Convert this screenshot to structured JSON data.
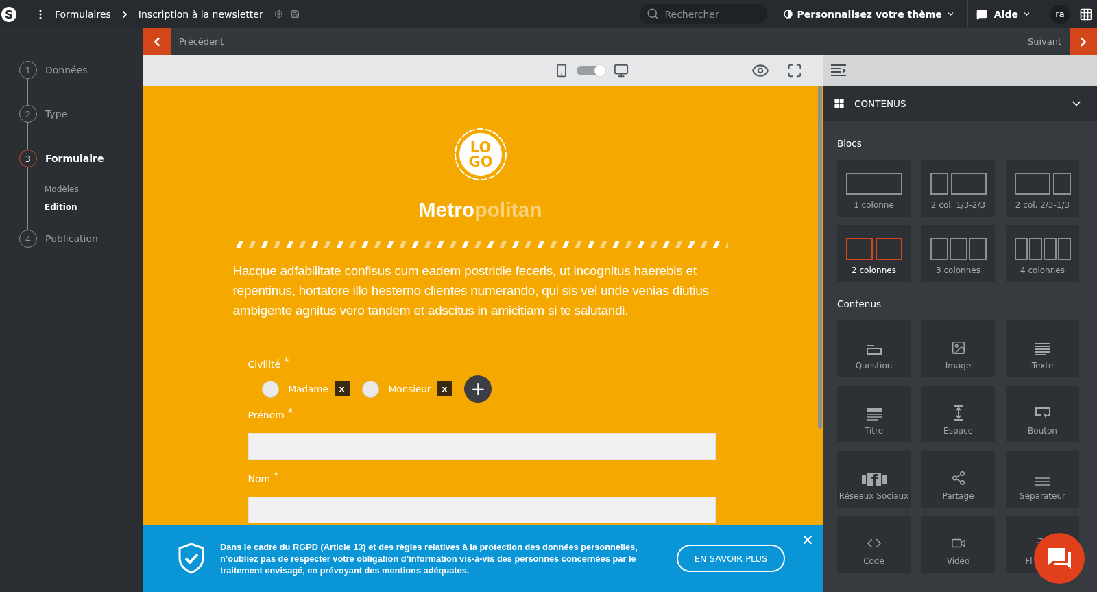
{
  "topbar": {
    "breadcrumbs": [
      {
        "label": "Formulaires"
      },
      {
        "label": "Inscription à la newsletter"
      }
    ],
    "search": {
      "placeholder": "Rechercher"
    },
    "theme": "Personnalisez votre thème",
    "help": "Aide",
    "avatar": "ra"
  },
  "nav": {
    "previous": "Précédent",
    "next": "Suivant"
  },
  "steps": [
    {
      "number": "1",
      "label": "Données",
      "selected": false
    },
    {
      "number": "2",
      "label": "Type",
      "selected": false
    },
    {
      "number": "3",
      "label": "Formulaire",
      "selected": true,
      "children": [
        {
          "label": "Modèles",
          "selected": false
        },
        {
          "label": "Edition",
          "selected": true
        }
      ]
    },
    {
      "number": "4",
      "label": "Publication",
      "selected": false
    }
  ],
  "toolbar": {
    "desktop": true
  },
  "canvas": {
    "logo": [
      "LO",
      "GO"
    ],
    "brand": {
      "strong": "Metro",
      "faded": "politan"
    },
    "intro": "Hacque adfabilitate confisus cum eadem postridie feceris, ut incognitus haerebis et repentinus, hortatore illo hesterno clientes numerando, qui sis vel unde venias diutius ambigente agnitus vero tandem et adscitus in amicitiam si te salutandi.",
    "fields": [
      {
        "kind": "radio",
        "label": "Civilité",
        "required_mark": "*",
        "options": [
          {
            "label": "Madame",
            "selected": false,
            "remove": "x"
          },
          {
            "label": "Monsieur",
            "selected": false,
            "remove": "x"
          }
        ],
        "add": "+"
      },
      {
        "kind": "text",
        "label": "Prénom",
        "required_mark": "*"
      },
      {
        "kind": "text",
        "label": "Nom",
        "required_mark": "*"
      }
    ]
  },
  "panel": {
    "title": "CONTENUS",
    "expanded": true,
    "sections": [
      {
        "title": "Blocs",
        "items": [
          {
            "kind": "one-col",
            "label": "1 colonne",
            "selected": false
          },
          {
            "kind": "third-twothirds",
            "label": "2 col. 1/3-2/3",
            "selected": false
          },
          {
            "kind": "twothirds-third",
            "label": "2 col. 2/3-1/3",
            "selected": false
          },
          {
            "kind": "two-col",
            "label": "2 colonnes",
            "selected": true
          },
          {
            "kind": "three-col",
            "label": "3 colonnes",
            "selected": false
          },
          {
            "kind": "four-col",
            "label": "4 colonnes",
            "selected": false
          }
        ]
      },
      {
        "title": "Contenus",
        "items": [
          {
            "kind": "question",
            "label": "Question",
            "selected": false
          },
          {
            "kind": "image",
            "label": "Image",
            "selected": false
          },
          {
            "kind": "text",
            "label": "Texte",
            "selected": false
          },
          {
            "kind": "title",
            "label": "Titre",
            "selected": false
          },
          {
            "kind": "space",
            "label": "Espace",
            "selected": false
          },
          {
            "kind": "button",
            "label": "Bouton",
            "selected": false
          },
          {
            "kind": "social",
            "label": "Réseaux Sociaux",
            "selected": false
          },
          {
            "kind": "share",
            "label": "Partage",
            "selected": false
          },
          {
            "kind": "separator",
            "label": "Séparateur",
            "selected": false
          },
          {
            "kind": "code",
            "label": "Code",
            "selected": false
          },
          {
            "kind": "video",
            "label": "Vidéo",
            "selected": false
          },
          {
            "kind": "feed",
            "label": "Fl",
            "selected": false
          }
        ]
      }
    ]
  },
  "banner": {
    "text": "Dans le cadre du RGPD (Article 13) et des règles relatives à la protection des données personnelles, n’oubliez pas de respecter votre obligation d’information vis-à-vis des personnes concernées par le traitement envisagé, en prévoyant des mentions adéquates.",
    "button": "EN SAVOIR PLUS"
  }
}
